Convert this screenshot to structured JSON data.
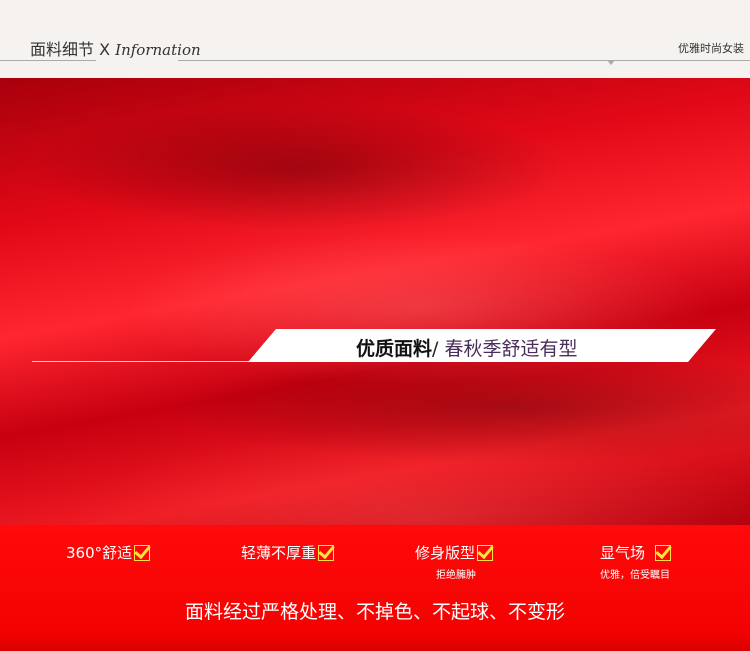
{
  "header": {
    "section_title_cn": "面料细节",
    "separator": "X",
    "section_title_en": "Infornation",
    "brand_tagline": "优雅时尚女装"
  },
  "banner": {
    "main": "优质面料",
    "slash": "/",
    "sub": "春秋季舒适有型"
  },
  "features": [
    {
      "label": "360°舒适",
      "sub": ""
    },
    {
      "label": "轻薄不厚重",
      "sub": ""
    },
    {
      "label": "修身版型",
      "sub": "拒绝臃肿"
    },
    {
      "label": "显气场",
      "sub": "优雅，倍受瞩目"
    }
  ],
  "slogan": "面料经过严格处理、不掉色、不起球、不变形",
  "colors": {
    "fabric_red": "#e00816",
    "band_red": "#ff0a0a",
    "check_yellow": "#ffe23a",
    "banner_sub_purple": "#4a2e5a"
  }
}
